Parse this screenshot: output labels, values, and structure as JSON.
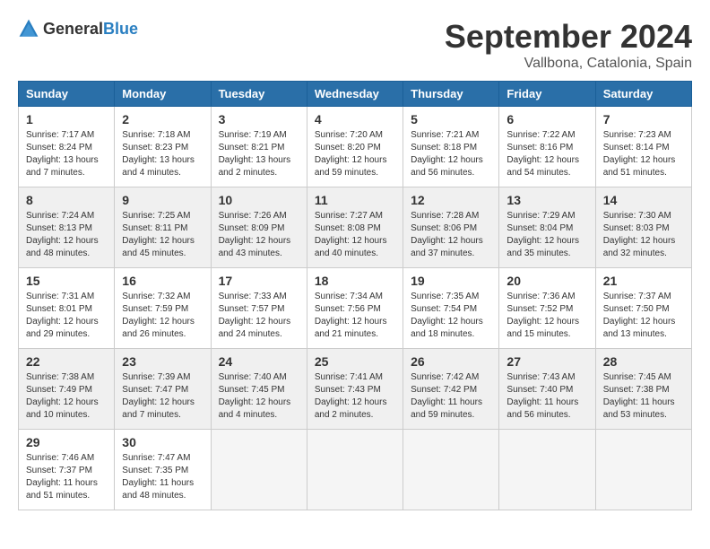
{
  "logo": {
    "general": "General",
    "blue": "Blue"
  },
  "header": {
    "month": "September 2024",
    "location": "Vallbona, Catalonia, Spain"
  },
  "weekdays": [
    "Sunday",
    "Monday",
    "Tuesday",
    "Wednesday",
    "Thursday",
    "Friday",
    "Saturday"
  ],
  "weeks": [
    [
      {
        "day": "1",
        "sunrise": "7:17 AM",
        "sunset": "8:24 PM",
        "daylight": "13 hours and 7 minutes"
      },
      {
        "day": "2",
        "sunrise": "7:18 AM",
        "sunset": "8:23 PM",
        "daylight": "13 hours and 4 minutes"
      },
      {
        "day": "3",
        "sunrise": "7:19 AM",
        "sunset": "8:21 PM",
        "daylight": "13 hours and 2 minutes"
      },
      {
        "day": "4",
        "sunrise": "7:20 AM",
        "sunset": "8:20 PM",
        "daylight": "12 hours and 59 minutes"
      },
      {
        "day": "5",
        "sunrise": "7:21 AM",
        "sunset": "8:18 PM",
        "daylight": "12 hours and 56 minutes"
      },
      {
        "day": "6",
        "sunrise": "7:22 AM",
        "sunset": "8:16 PM",
        "daylight": "12 hours and 54 minutes"
      },
      {
        "day": "7",
        "sunrise": "7:23 AM",
        "sunset": "8:14 PM",
        "daylight": "12 hours and 51 minutes"
      }
    ],
    [
      {
        "day": "8",
        "sunrise": "7:24 AM",
        "sunset": "8:13 PM",
        "daylight": "12 hours and 48 minutes"
      },
      {
        "day": "9",
        "sunrise": "7:25 AM",
        "sunset": "8:11 PM",
        "daylight": "12 hours and 45 minutes"
      },
      {
        "day": "10",
        "sunrise": "7:26 AM",
        "sunset": "8:09 PM",
        "daylight": "12 hours and 43 minutes"
      },
      {
        "day": "11",
        "sunrise": "7:27 AM",
        "sunset": "8:08 PM",
        "daylight": "12 hours and 40 minutes"
      },
      {
        "day": "12",
        "sunrise": "7:28 AM",
        "sunset": "8:06 PM",
        "daylight": "12 hours and 37 minutes"
      },
      {
        "day": "13",
        "sunrise": "7:29 AM",
        "sunset": "8:04 PM",
        "daylight": "12 hours and 35 minutes"
      },
      {
        "day": "14",
        "sunrise": "7:30 AM",
        "sunset": "8:03 PM",
        "daylight": "12 hours and 32 minutes"
      }
    ],
    [
      {
        "day": "15",
        "sunrise": "7:31 AM",
        "sunset": "8:01 PM",
        "daylight": "12 hours and 29 minutes"
      },
      {
        "day": "16",
        "sunrise": "7:32 AM",
        "sunset": "7:59 PM",
        "daylight": "12 hours and 26 minutes"
      },
      {
        "day": "17",
        "sunrise": "7:33 AM",
        "sunset": "7:57 PM",
        "daylight": "12 hours and 24 minutes"
      },
      {
        "day": "18",
        "sunrise": "7:34 AM",
        "sunset": "7:56 PM",
        "daylight": "12 hours and 21 minutes"
      },
      {
        "day": "19",
        "sunrise": "7:35 AM",
        "sunset": "7:54 PM",
        "daylight": "12 hours and 18 minutes"
      },
      {
        "day": "20",
        "sunrise": "7:36 AM",
        "sunset": "7:52 PM",
        "daylight": "12 hours and 15 minutes"
      },
      {
        "day": "21",
        "sunrise": "7:37 AM",
        "sunset": "7:50 PM",
        "daylight": "12 hours and 13 minutes"
      }
    ],
    [
      {
        "day": "22",
        "sunrise": "7:38 AM",
        "sunset": "7:49 PM",
        "daylight": "12 hours and 10 minutes"
      },
      {
        "day": "23",
        "sunrise": "7:39 AM",
        "sunset": "7:47 PM",
        "daylight": "12 hours and 7 minutes"
      },
      {
        "day": "24",
        "sunrise": "7:40 AM",
        "sunset": "7:45 PM",
        "daylight": "12 hours and 4 minutes"
      },
      {
        "day": "25",
        "sunrise": "7:41 AM",
        "sunset": "7:43 PM",
        "daylight": "12 hours and 2 minutes"
      },
      {
        "day": "26",
        "sunrise": "7:42 AM",
        "sunset": "7:42 PM",
        "daylight": "11 hours and 59 minutes"
      },
      {
        "day": "27",
        "sunrise": "7:43 AM",
        "sunset": "7:40 PM",
        "daylight": "11 hours and 56 minutes"
      },
      {
        "day": "28",
        "sunrise": "7:45 AM",
        "sunset": "7:38 PM",
        "daylight": "11 hours and 53 minutes"
      }
    ],
    [
      {
        "day": "29",
        "sunrise": "7:46 AM",
        "sunset": "7:37 PM",
        "daylight": "11 hours and 51 minutes"
      },
      {
        "day": "30",
        "sunrise": "7:47 AM",
        "sunset": "7:35 PM",
        "daylight": "11 hours and 48 minutes"
      },
      null,
      null,
      null,
      null,
      null
    ]
  ]
}
